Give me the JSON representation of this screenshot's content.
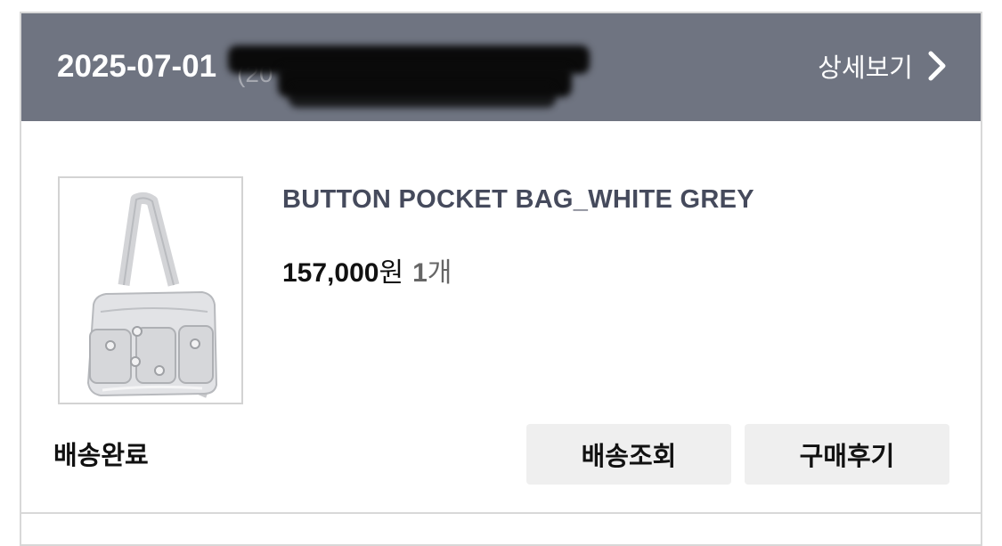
{
  "order": {
    "date": "2025-07-01",
    "date_suffix": "(20",
    "detail_link_label": "상세보기",
    "detail_icon": "chevron-right-icon"
  },
  "product": {
    "name": "BUTTON POCKET BAG_WHITE GREY",
    "price_amount": "157,000",
    "price_unit": "원",
    "quantity": "1",
    "quantity_unit": "개",
    "image": "white-grey-shoulder-bag"
  },
  "status": {
    "label": "배송완료"
  },
  "actions": {
    "track_label": "배송조회",
    "review_label": "구매후기"
  },
  "colors": {
    "header_bg": "#6f7481",
    "button_bg": "#efefef",
    "product_name": "#454a5c"
  }
}
